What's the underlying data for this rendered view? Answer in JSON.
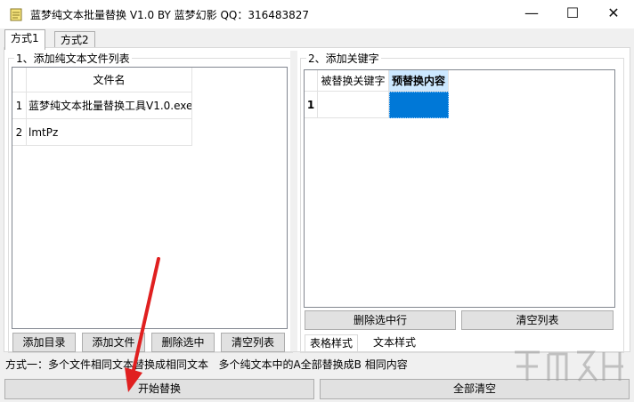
{
  "window": {
    "title": "蓝梦纯文本批量替换 V1.0 BY 蓝梦幻影 QQ：316483827",
    "minimize_glyph": "—",
    "maximize_glyph": "☐",
    "close_glyph": "✕"
  },
  "tabs": [
    {
      "label": "方式1",
      "active": true
    },
    {
      "label": "方式2",
      "active": false
    }
  ],
  "left_group": {
    "title": "1、添加纯文本文件列表",
    "column_header": "文件名",
    "rows": [
      {
        "index": "1",
        "name": "蓝梦纯文本批量替换工具V1.0.exe"
      },
      {
        "index": "2",
        "name": "lmtPz"
      }
    ],
    "buttons": {
      "add_dir": "添加目录",
      "add_file": "添加文件",
      "delete_selected": "删除选中",
      "clear_list": "清空列表"
    }
  },
  "right_group": {
    "title": "2、添加关键字",
    "columns": [
      "被替换关键字",
      "预替换内容"
    ],
    "rows": [
      {
        "index": "1",
        "keyword": "",
        "replacement": ""
      }
    ],
    "buttons": {
      "delete_selected_row": "删除选中行",
      "clear_list": "清空列表"
    },
    "subtabs": [
      {
        "label": "表格样式",
        "active": true
      },
      {
        "label": "文本样式",
        "active": false
      }
    ]
  },
  "status_text": "方式一：多个文件相同文本替换成相同文本   多个纯文本中的A全部替换成B 相同内容",
  "bottom_buttons": {
    "start": "开始替换",
    "clear_all": "全部清空"
  },
  "colors": {
    "selection": "#0078d7",
    "header_highlight": "#cce8ff",
    "arrow": "#e02020"
  }
}
